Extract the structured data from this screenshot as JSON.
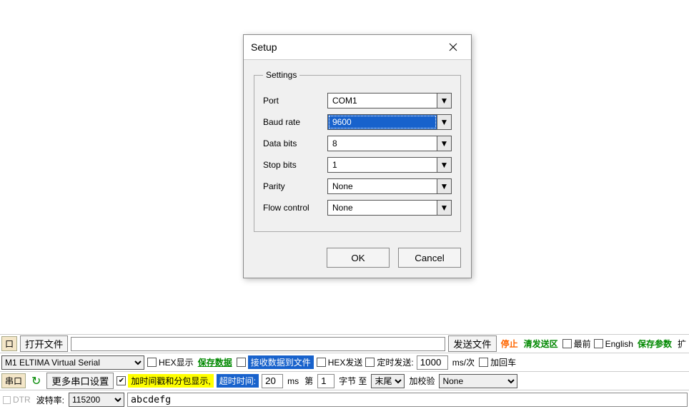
{
  "dialog": {
    "title": "Setup",
    "group": "Settings",
    "fields": {
      "port": {
        "label": "Port",
        "value": "COM1"
      },
      "baud": {
        "label": "Baud rate",
        "value": "9600"
      },
      "databits": {
        "label": "Data bits",
        "value": "8"
      },
      "stopbits": {
        "label": "Stop bits",
        "value": "1"
      },
      "parity": {
        "label": "Parity",
        "value": "None"
      },
      "flow": {
        "label": "Flow control",
        "value": "None"
      }
    },
    "ok": "OK",
    "cancel": "Cancel"
  },
  "bottom": {
    "row1": {
      "port_fragment": "口",
      "open_file": "打开文件",
      "send_file": "发送文件",
      "stop": "停止",
      "clear_send": "清发送区",
      "topmost": "最前",
      "english": "English",
      "save_params": "保存参数",
      "expand_frag": "扩"
    },
    "row2": {
      "port_name": "M1 ELTIMA Virtual Serial",
      "hex_show": "HEX显示",
      "save_data": "保存数据",
      "recv_to_file": "接收数据到文件",
      "hex_send": "HEX发送",
      "timed_send_label": "定时发送:",
      "timed_send_value": "1000",
      "timed_send_unit": "ms/次",
      "add_cr": "加回车"
    },
    "row3": {
      "port_btn": "串口",
      "more_settings": "更多串口设置",
      "timestamp_split": "加时间戳和分包显示,",
      "timeout_label": "超时时间:",
      "timeout_value": "20",
      "timeout_unit": "ms",
      "nth_label1": "第",
      "nth_value": "1",
      "nth_label2": "字节 至",
      "tail": "末尾",
      "add_checksum": "加校验",
      "checksum_value": "None"
    },
    "row4": {
      "dtr_frag": "DTR",
      "baud_label": "波特率:",
      "baud_value": "115200",
      "send_text": "abcdefg"
    }
  }
}
